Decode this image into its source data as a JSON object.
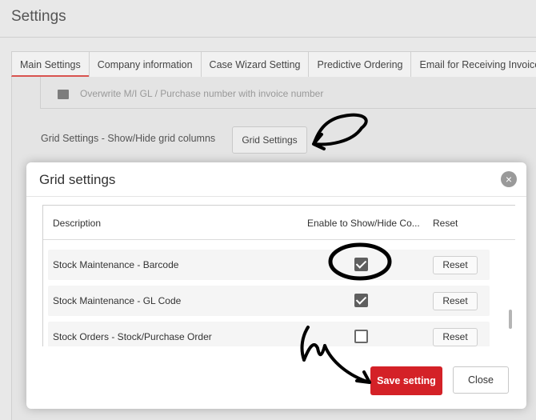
{
  "page": {
    "title": "Settings"
  },
  "tabs": [
    {
      "label": "Main Settings"
    },
    {
      "label": "Company information"
    },
    {
      "label": "Case Wizard Setting"
    },
    {
      "label": "Predictive Ordering"
    },
    {
      "label": "Email for Receiving Invoice"
    }
  ],
  "main": {
    "cut_row_text": "Overwrite M/I GL / Purchase number with invoice number",
    "grid_settings_label": "Grid Settings - Show/Hide grid columns",
    "grid_settings_button": "Grid Settings"
  },
  "modal": {
    "title": "Grid settings",
    "close_icon": "×",
    "columns": [
      "Description",
      "Enable to Show/Hide Co...",
      "Reset"
    ],
    "rows": [
      {
        "description": "Stock Maintenance - Barcode",
        "enabled": true,
        "reset": "Reset"
      },
      {
        "description": "Stock Maintenance - GL Code",
        "enabled": true,
        "reset": "Reset"
      },
      {
        "description": "Stock Orders - Stock/Purchase Order",
        "enabled": false,
        "reset": "Reset"
      }
    ],
    "save_button": "Save setting",
    "close_button": "Close"
  },
  "colors": {
    "accent_red": "#d42127",
    "tab_underline": "#d9534f"
  }
}
